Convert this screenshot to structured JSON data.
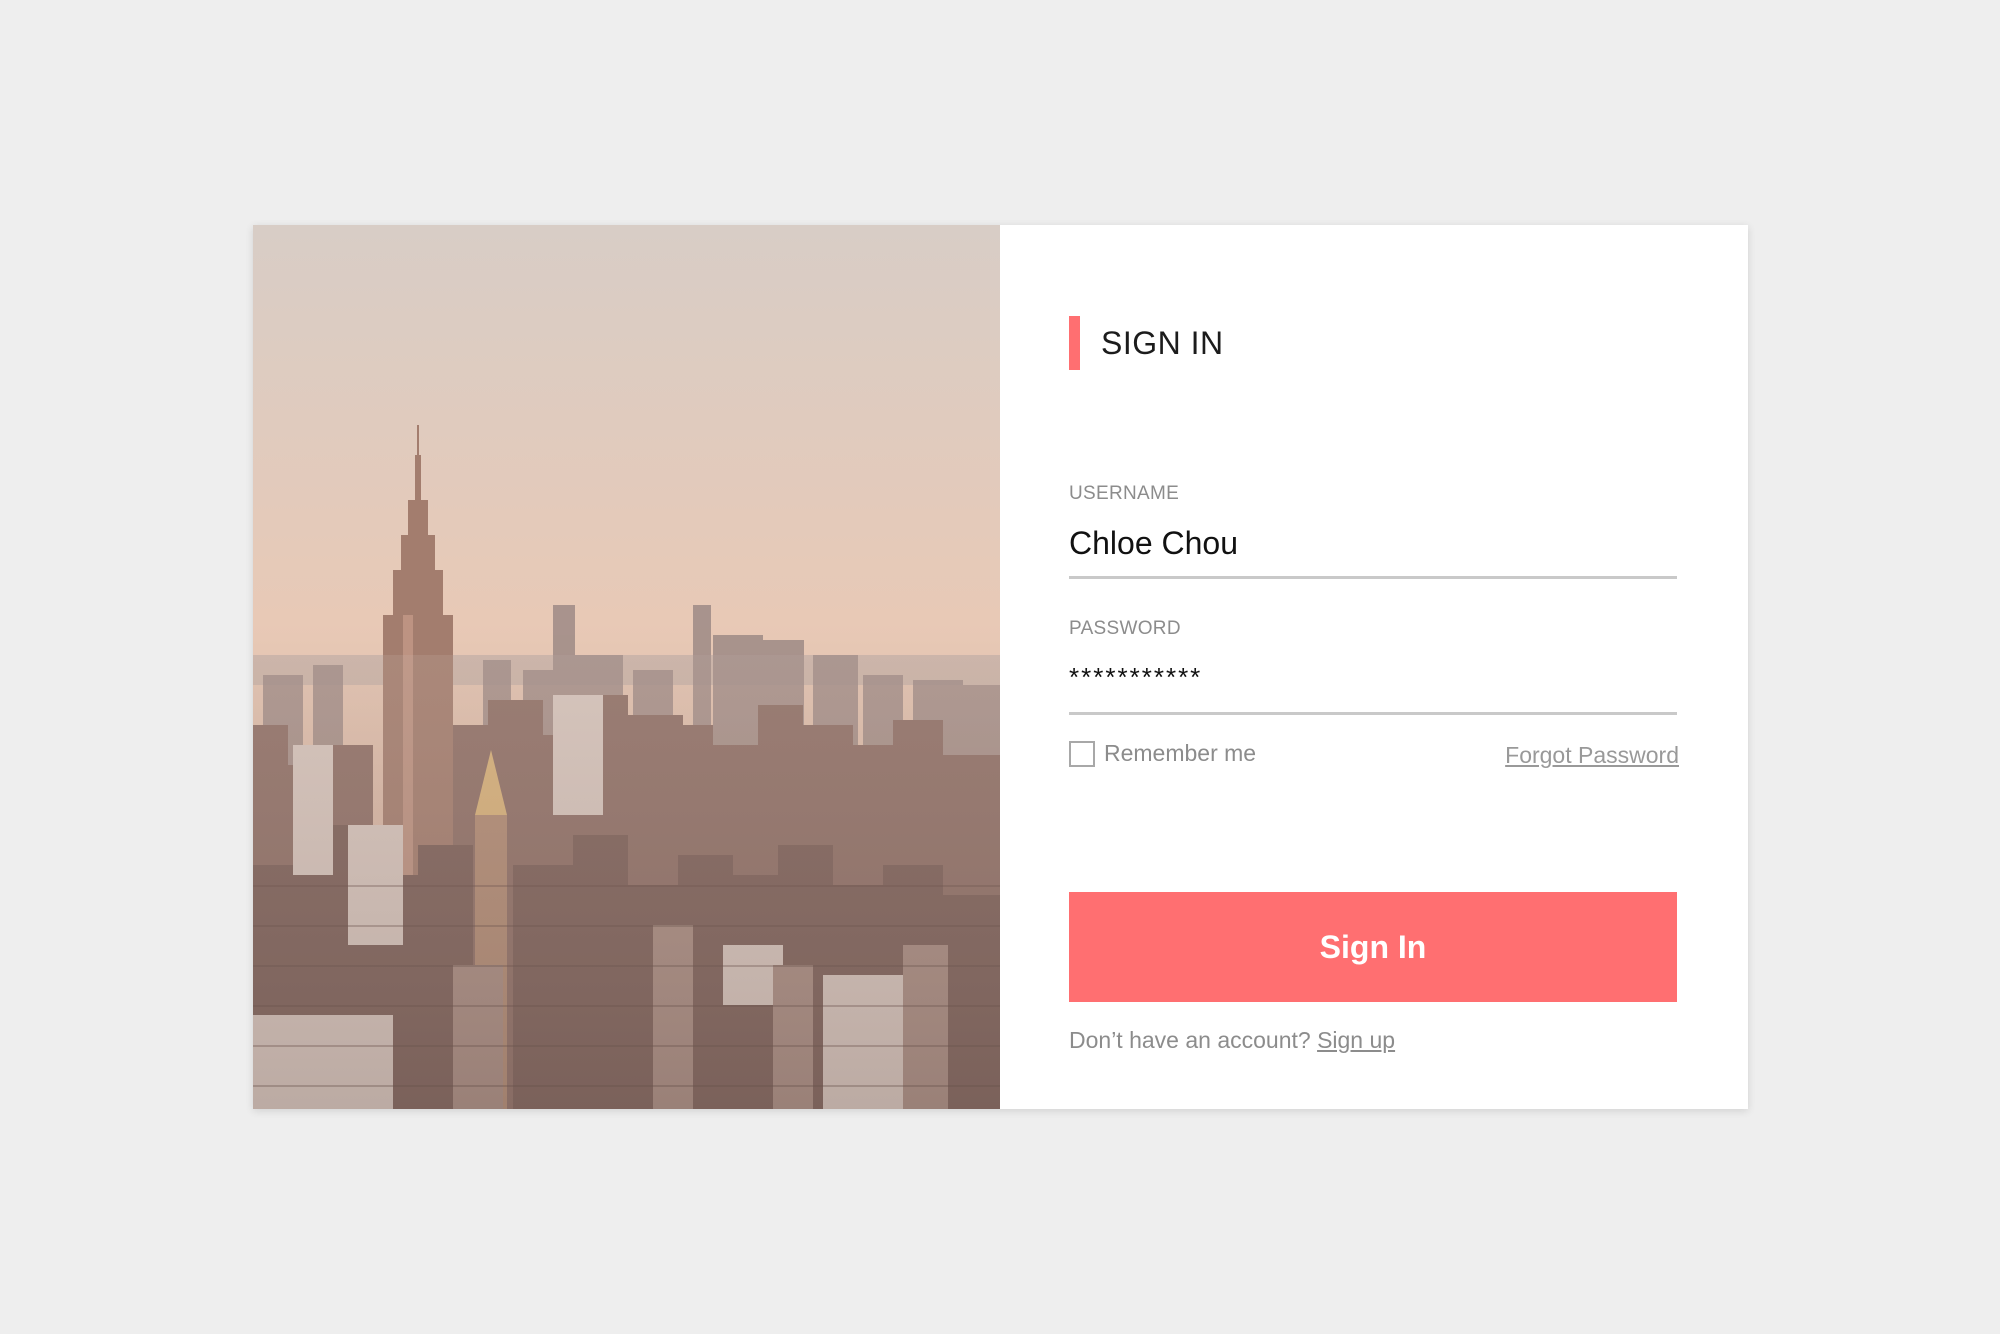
{
  "form": {
    "heading": "SIGN IN",
    "username": {
      "label": "USERNAME",
      "value": "Chloe Chou"
    },
    "password": {
      "label": "PASSWORD",
      "value": "***********"
    },
    "remember_label": "Remember me",
    "remember_checked": false,
    "forgot_label": "Forgot Password",
    "submit_label": "Sign In",
    "signup_prompt": "Don’t have an account?",
    "signup_link": "Sign up"
  },
  "colors": {
    "accent": "#ff6f71",
    "background": "#eeeeee",
    "card": "#ffffff"
  },
  "image": {
    "subject": "city-skyline-photo"
  }
}
